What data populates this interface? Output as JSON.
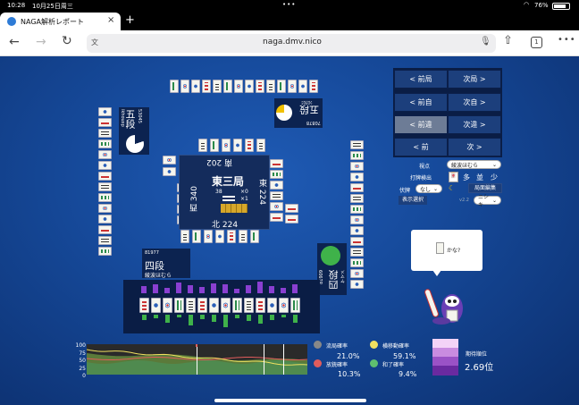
{
  "status": {
    "time": "10:28",
    "date": "10月25日周三",
    "battery": "76%"
  },
  "tab": {
    "title": "NAGA解析レポート",
    "close": "×",
    "new_tab": "+"
  },
  "browser": {
    "url": "naga.dmv.nico",
    "tab_count": "1"
  },
  "round": {
    "name": "東三局",
    "honba": "38",
    "counter1": "×0",
    "counter2": "×1"
  },
  "scores": {
    "south": "南 202",
    "west": "西 340",
    "east": "東 224",
    "north": "北 224"
  },
  "players": {
    "top": {
      "rank": "五段",
      "name": "ｼﾛｸﾛﾐ",
      "id": "70878"
    },
    "left": {
      "rank": "五段",
      "name": "ikhouxp",
      "id": "53045"
    },
    "bottom": {
      "rank": "四段",
      "name": "綾波ほむら",
      "id": "81977"
    },
    "right": {
      "rank": "四段",
      "name": "ヤマメ",
      "id": "81909"
    }
  },
  "nav": {
    "prev_round": "< 前局",
    "next_round": "次局 >",
    "prev_self": "< 前自",
    "next_self": "次自 >",
    "prev_diff": "< 前違",
    "next_diff": "次違 >",
    "prev": "< 前",
    "next": "次 >"
  },
  "controls": {
    "viewpoint_label": "視点",
    "viewpoint_value": "綾波ほむら",
    "discard_detect_label": "打牌検出",
    "fold_label": "伏牌",
    "fold_value": "なし",
    "opt_many": "多",
    "opt_mid": "並",
    "opt_few": "少",
    "layout_edit": "局面編集",
    "display_select": "表示選択",
    "version": "v2.2",
    "model_value": "ニシキ"
  },
  "bubble": {
    "text": "かな?"
  },
  "stats": {
    "ryukyoku_label": "流局確率",
    "ryukyoku_value": "21.0%",
    "houju_label": "放銃確率",
    "houju_value": "10.3%",
    "yokodori_label": "横移動確率",
    "yokodori_value": "59.1%",
    "agari_label": "和了確率",
    "agari_value": "9.4%",
    "expected_label": "期待順位",
    "expected_value": "2.69位",
    "ticks": [
      "100",
      "75",
      "50",
      "25",
      "0"
    ]
  },
  "colors": {
    "ryukyoku": "#888888",
    "houju": "#e05c5c",
    "yokodori": "#f0e060",
    "agari": "#5fbf6f",
    "panel": "#0d2654",
    "btn": "#1c3f7c",
    "btn_dim": "#6d7c96"
  }
}
